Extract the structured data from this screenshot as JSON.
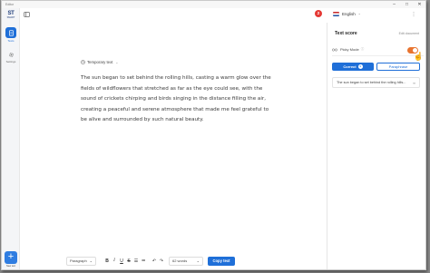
{
  "window": {
    "title": "Editor"
  },
  "rail": {
    "logo": "ST",
    "logo_sub": "SMART",
    "items": [
      {
        "label": "Texts",
        "icon": "document-icon",
        "active": true
      },
      {
        "label": "Settings",
        "icon": "gear-icon",
        "active": false
      }
    ],
    "new_label": "New text"
  },
  "header": {
    "notification_count": "2",
    "language": "English"
  },
  "document": {
    "tag": "Temporary text",
    "body": "The sun began to set behind the rolling hills, casting a warm glow over the fields of wildflowers that stretched as far as the eye could see, with the sound of crickets chirping and birds singing in the distance filling the air, creating a peaceful and serene atmosphere that made me feel grateful to be alive and surrounded by such natural beauty."
  },
  "panel": {
    "title": "Text score",
    "link": "Edit document",
    "picky_mode_label": "Picky Mode",
    "picky_mode_on": true,
    "tabs": [
      {
        "label": "Correct",
        "count": "1",
        "active": true
      },
      {
        "label": "Paraphrase",
        "active": false
      }
    ],
    "suggestion": "The sun began to set behind the rolling hills..."
  },
  "toolbar": {
    "style_select": "Paragraph",
    "word_count": "62 words",
    "copy_label": "Copy text"
  },
  "colors": {
    "accent": "#1f6fd8",
    "toggle": "#e8742f",
    "badge": "#e53935"
  }
}
